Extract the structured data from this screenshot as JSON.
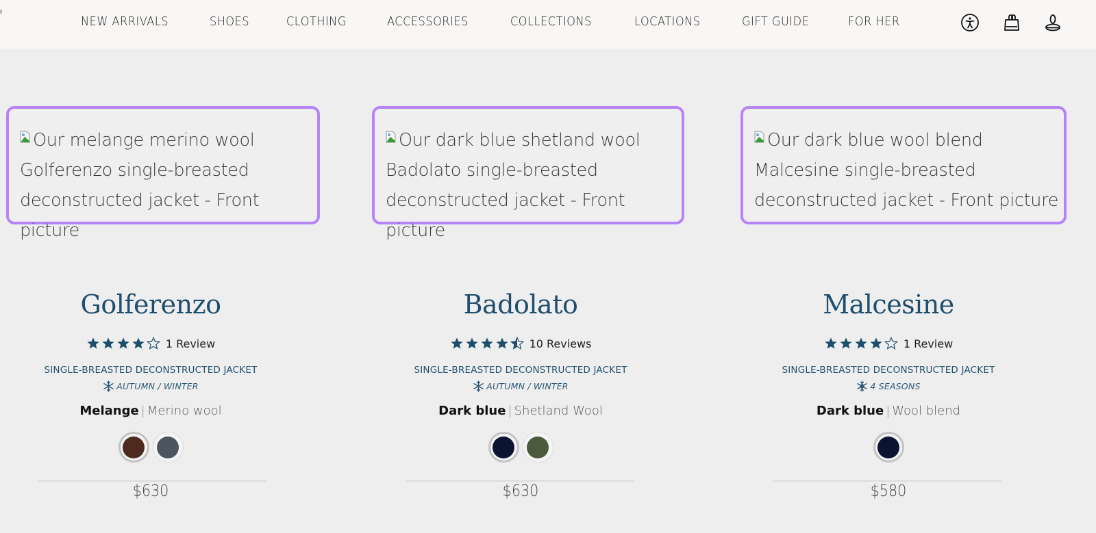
{
  "header": {
    "nav": [
      {
        "label": "NEW ARRIVALS"
      },
      {
        "label": "SHOES"
      },
      {
        "label": "CLOTHING"
      },
      {
        "label": "ACCESSORIES"
      },
      {
        "label": "COLLECTIONS"
      },
      {
        "label": "LOCATIONS"
      },
      {
        "label": "GIFT GUIDE"
      },
      {
        "label": "FOR HER"
      }
    ],
    "icons": [
      "accessibility-icon",
      "shopping-bag-icon",
      "account-icon"
    ]
  },
  "colors": {
    "accent": "#1e4e6e",
    "highlight_border": "#b784f7",
    "background": "#eeeeee",
    "header_bg": "#f8f7f6"
  },
  "products": [
    {
      "image_alt": "Our melange merino wool Golferenzo single-breasted deconstructed jacket - Front picture",
      "name": "Golferenzo",
      "rating": 4,
      "rating_max": 5,
      "reviews": "1 Review",
      "category": "SINGLE-BREASTED DECONSTRUCTED JACKET",
      "season": "AUTUMN / WINTER",
      "season_icon": "snowflake-icon",
      "color_name": "Melange",
      "material": "Merino wool",
      "swatches": [
        {
          "color": "#4e2a1e",
          "selected": true
        },
        {
          "color": "#4a5560",
          "selected": false
        }
      ],
      "price": "$630"
    },
    {
      "image_alt": "Our dark blue shetland wool Badolato single-breasted deconstructed jacket - Front picture",
      "name": "Badolato",
      "rating": 4.5,
      "rating_max": 5,
      "reviews": "10 Reviews",
      "category": "SINGLE-BREASTED DECONSTRUCTED JACKET",
      "season": "AUTUMN / WINTER",
      "season_icon": "snowflake-icon",
      "color_name": "Dark blue",
      "material": "Shetland Wool",
      "swatches": [
        {
          "color": "#0b1430",
          "selected": true
        },
        {
          "color": "#4b5a3b",
          "selected": false
        }
      ],
      "price": "$630"
    },
    {
      "image_alt": "Our dark blue wool blend Malcesine single-breasted deconstructed jacket - Front picture",
      "name": "Malcesine",
      "rating": 4,
      "rating_max": 5,
      "reviews": "1 Review",
      "category": "SINGLE-BREASTED DECONSTRUCTED JACKET",
      "season": "4 SEASONS",
      "season_icon": "sun-snowflake-icon",
      "color_name": "Dark blue",
      "material": "Wool blend",
      "swatches": [
        {
          "color": "#0b1430",
          "selected": true
        }
      ],
      "price": "$580"
    }
  ]
}
